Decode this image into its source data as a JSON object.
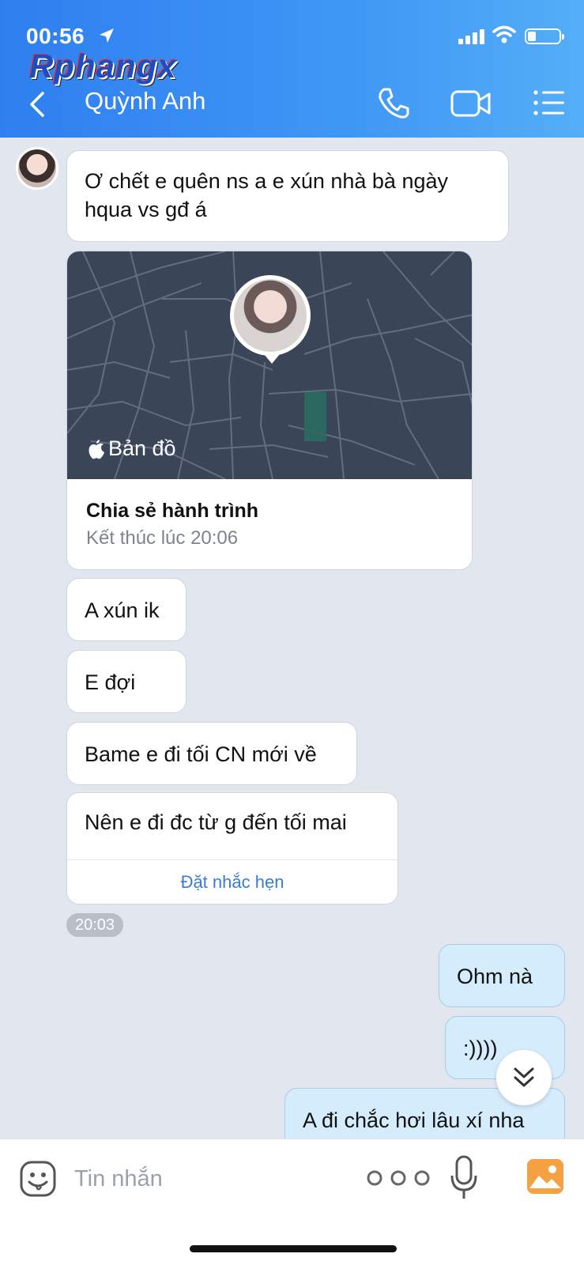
{
  "status_bar": {
    "time": "00:56"
  },
  "watermark": "Rphangx",
  "header": {
    "contact_name": "Quỳnh Anh"
  },
  "messages": {
    "m1": "Ơ chết e quên ns a e xún nhà bà ngày hqua vs gđ á",
    "map_card": {
      "brand": "Bản đồ",
      "title": "Chia sẻ hành trình",
      "subtitle": "Kết thúc lúc 20:06"
    },
    "m2": "A xún ik",
    "m3": "E đợi",
    "m4": "Bame e đi tối CN mới về",
    "m5": "Nên e đi đc từ g đến tối mai",
    "remind_label": "Đặt nhắc hẹn",
    "time_badge": "20:03",
    "s1": "Ohm nà",
    "s2": ":))))",
    "s3": "A đi chắc hơi lâu xí nha"
  },
  "input": {
    "placeholder": "Tin nhắn"
  },
  "icons": {
    "back": "chevron-left-icon",
    "call": "phone-icon",
    "video": "video-camera-icon",
    "menu": "list-menu-icon",
    "scroll": "double-chevron-down-icon",
    "emoji": "sticker-icon",
    "more": "more-dots-icon",
    "mic": "microphone-icon",
    "photo": "image-icon"
  },
  "colors": {
    "header": "#3a8ef3",
    "sent_bubble": "#d5ecfc",
    "received_bubble": "#ffffff",
    "background": "#e2e7ef",
    "link": "#3a7bd5",
    "photo_icon": "#f5a142"
  }
}
